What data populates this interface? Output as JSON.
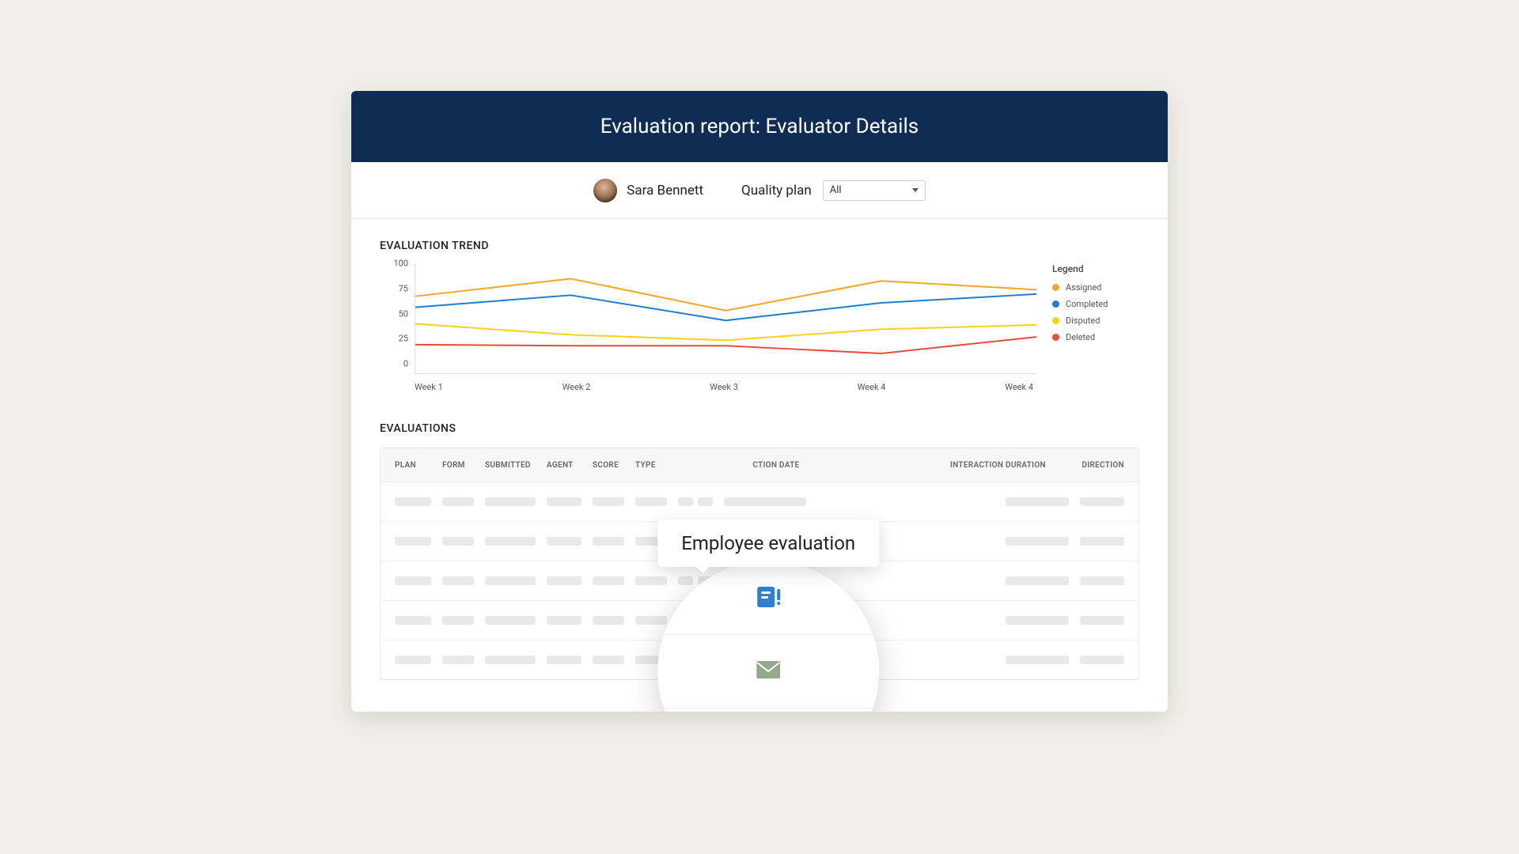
{
  "header": {
    "title": "Evaluation report: Evaluator Details"
  },
  "filter": {
    "user_name": "Sara Bennett",
    "quality_plan_label": "Quality plan",
    "quality_plan_value": "All"
  },
  "chart": {
    "title": "EVALUATION TREND",
    "legend_title": "Legend",
    "y_ticks": [
      "100",
      "75",
      "50",
      "25",
      "0"
    ]
  },
  "chart_data": {
    "type": "line",
    "categories": [
      "Week 1",
      "Week 2",
      "Week 3",
      "Week 4",
      "Week 4"
    ],
    "ylim": [
      0,
      100
    ],
    "series": [
      {
        "name": "Assigned",
        "color": "#f5a623",
        "values": [
          70,
          86,
          57,
          84,
          76
        ]
      },
      {
        "name": "Completed",
        "color": "#1e7dd1",
        "values": [
          60,
          71,
          48,
          64,
          72
        ]
      },
      {
        "name": "Disputed",
        "color": "#f7d21a",
        "values": [
          45,
          35,
          30,
          40,
          44
        ]
      },
      {
        "name": "Deleted",
        "color": "#e74c3c",
        "values": [
          26,
          25,
          25,
          18,
          33
        ]
      }
    ]
  },
  "evaluations": {
    "title": "EVALUATIONS",
    "columns": [
      "PLAN",
      "FORM",
      "SUBMITTED",
      "AGENT",
      "SCORE",
      "TYPE",
      "INTERACTION DATE",
      "INTERACTION DURATION",
      "DIRECTION"
    ]
  },
  "popover": {
    "label": "Employee evaluation",
    "icons": [
      "form-alert-icon",
      "mail-icon",
      "chat-icon"
    ]
  },
  "colors": {
    "header_bg": "#0f2d54",
    "page_bg": "#f1efe9",
    "accent_blue": "#2d7fd3",
    "muted_green": "#93a989"
  }
}
